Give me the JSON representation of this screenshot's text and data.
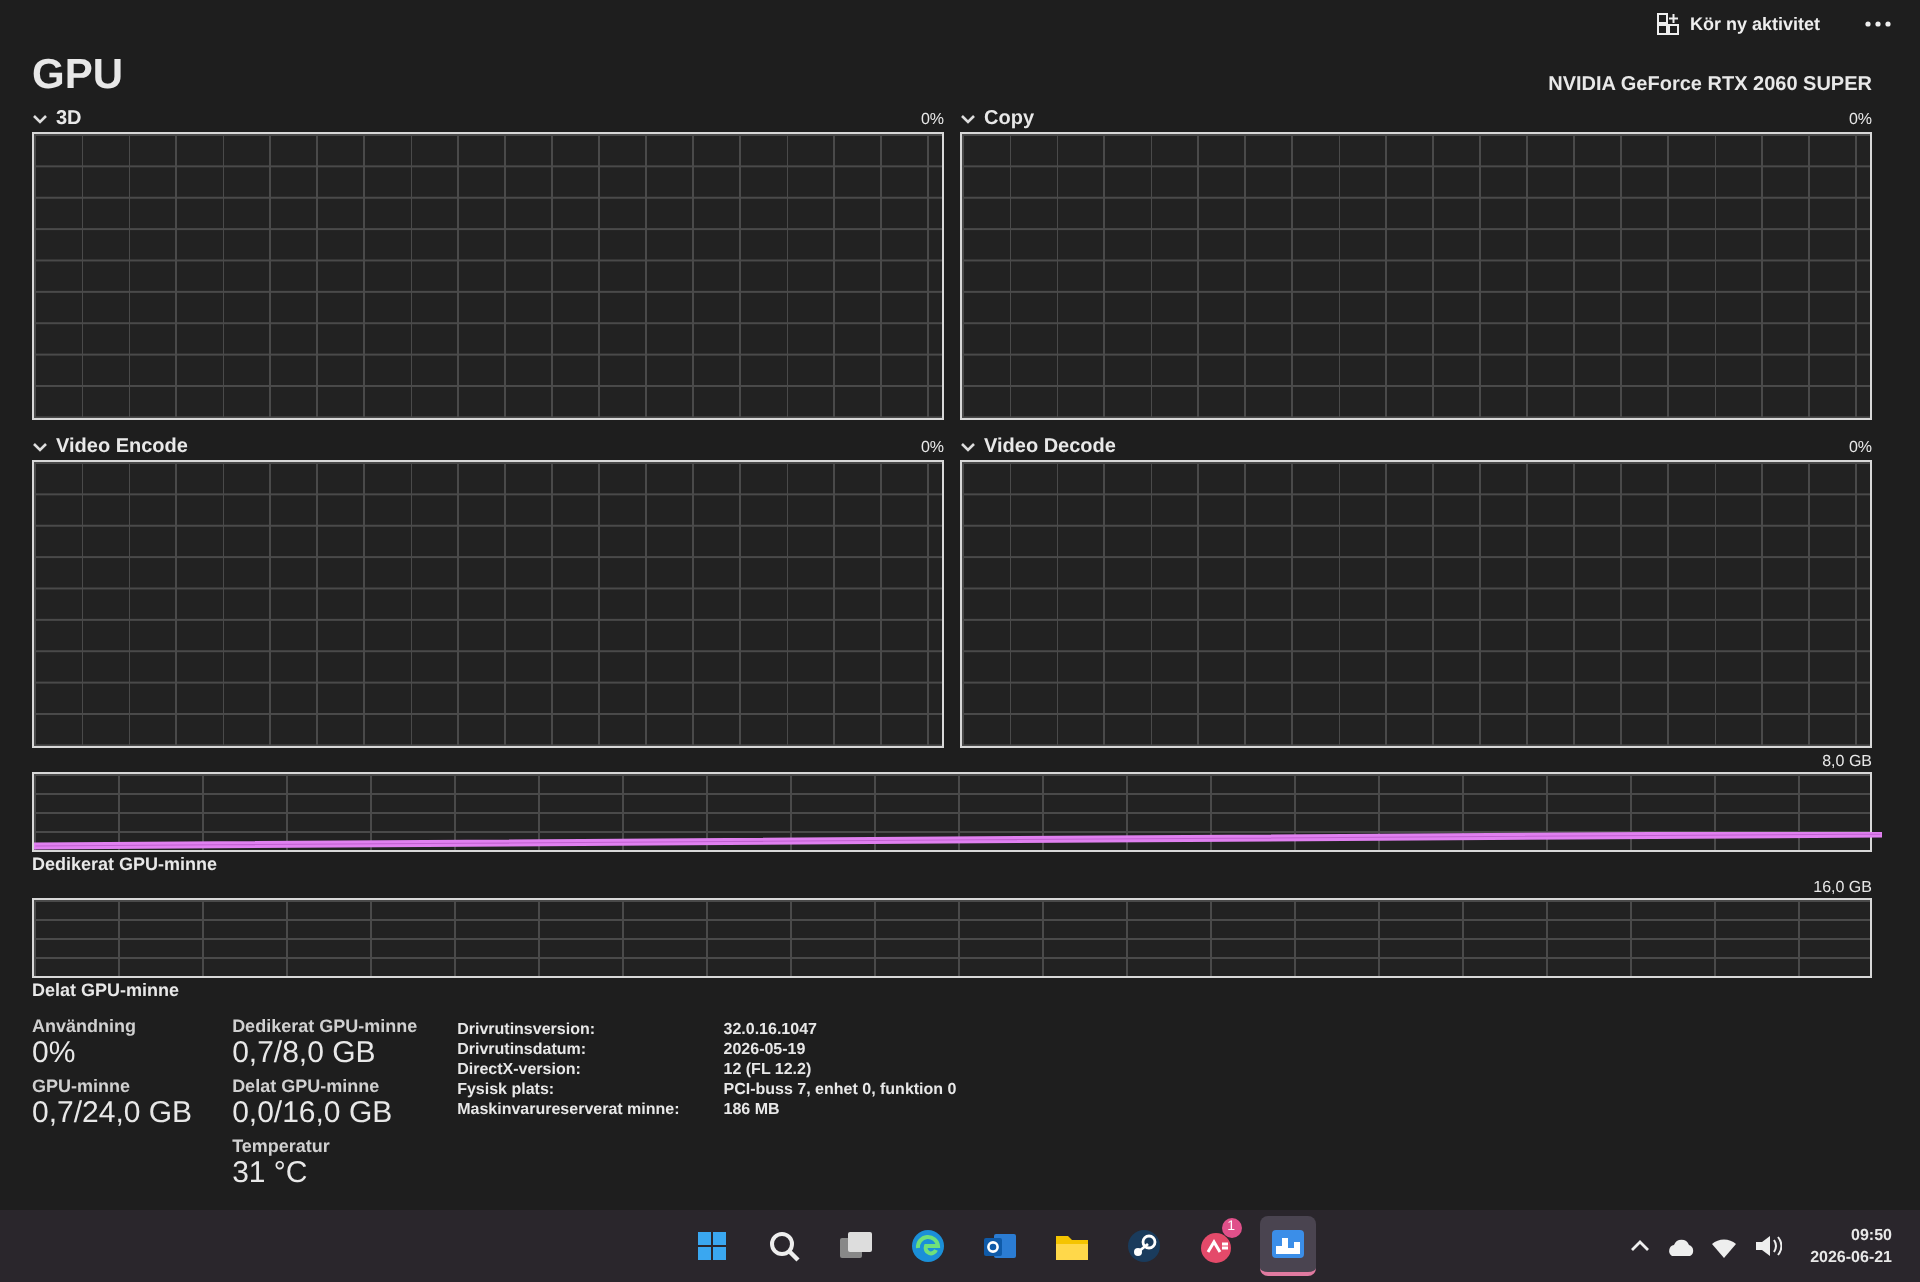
{
  "toolbar": {
    "run_task": "Kör ny aktivitet"
  },
  "title": "GPU",
  "gpu_name": "NVIDIA GeForce RTX 2060 SUPER",
  "engines": [
    {
      "name": "3D",
      "reading": "0%"
    },
    {
      "name": "Copy",
      "reading": "0%"
    },
    {
      "name": "Video Encode",
      "reading": "0%"
    },
    {
      "name": "Video Decode",
      "reading": "0%"
    }
  ],
  "memory_charts": [
    {
      "name": "Dedikerat GPU-minne",
      "max": "8,0 GB",
      "kind": "dedicated"
    },
    {
      "name": "Delat GPU-minne",
      "max": "16,0 GB",
      "kind": "shared"
    }
  ],
  "stats": [
    [
      {
        "label": "Användning",
        "value": "0%"
      },
      {
        "label": "GPU-minne",
        "value": "0,7/24,0 GB"
      }
    ],
    [
      {
        "label": "Dedikerat GPU-minne",
        "value": "0,7/8,0 GB"
      },
      {
        "label": "Delat GPU-minne",
        "value": "0,0/16,0 GB"
      },
      {
        "label": "Temperatur",
        "value": "31 °C"
      }
    ]
  ],
  "details": [
    {
      "label": "Drivrutinsversion:",
      "value": "32.0.16.1047"
    },
    {
      "label": "Drivrutinsdatum:",
      "value": "2026-05-19"
    },
    {
      "label": "DirectX-version:",
      "value": "12 (FL 12.2)"
    },
    {
      "label": "Fysisk plats:",
      "value": "PCI-buss 7, enhet 0, funktion 0"
    },
    {
      "label": "Maskinvarureserverat minne:",
      "value": "186 MB"
    }
  ],
  "taskbar": {
    "apps": [
      {
        "kind": "start",
        "selected": false
      },
      {
        "kind": "search",
        "selected": false
      },
      {
        "kind": "taskview",
        "selected": false
      },
      {
        "kind": "browser",
        "selected": false
      },
      {
        "kind": "mail",
        "selected": false
      },
      {
        "kind": "folder",
        "selected": false
      },
      {
        "kind": "steam",
        "selected": false
      },
      {
        "kind": "game",
        "selected": false,
        "badge": "1"
      },
      {
        "kind": "taskmanager",
        "selected": true
      }
    ],
    "time": "09:50",
    "date": "2026-06-21"
  }
}
